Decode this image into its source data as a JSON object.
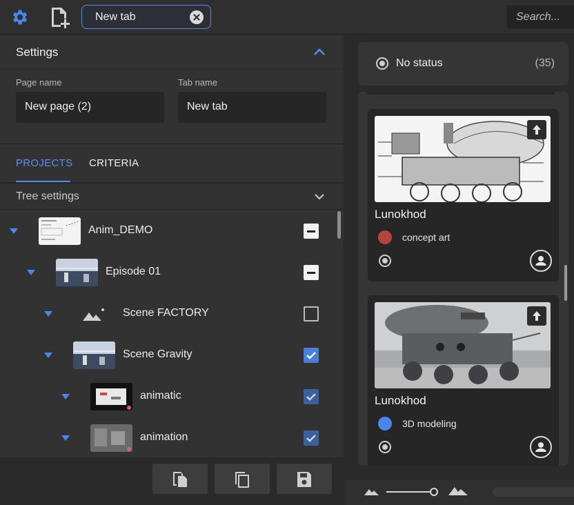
{
  "topbar": {
    "tab_name": "New tab",
    "search_placeholder": "Search..."
  },
  "settings": {
    "title": "Settings",
    "page_name_label": "Page name",
    "page_name_value": "New page (2)",
    "tab_name_label": "Tab name",
    "tab_name_value": "New tab"
  },
  "tabs": [
    {
      "label": "PROJECTS",
      "active": true
    },
    {
      "label": "CRITERIA",
      "active": false
    }
  ],
  "tree_settings_label": "Tree settings",
  "tree": [
    {
      "label": "Anim_DEMO",
      "depth": 0,
      "check": "indeterminate"
    },
    {
      "label": "Episode 01",
      "depth": 1,
      "check": "indeterminate"
    },
    {
      "label": "Scene FACTORY",
      "depth": 2,
      "check": "unchecked"
    },
    {
      "label": "Scene Gravity",
      "depth": 2,
      "check": "checked"
    },
    {
      "label": "animatic",
      "depth": 3,
      "check": "checked"
    },
    {
      "label": "animation",
      "depth": 3,
      "check": "checked"
    }
  ],
  "status": {
    "label": "No status",
    "count": "(35)"
  },
  "cards": [
    {
      "title": "Lunokhod",
      "tag": "concept art",
      "tag_color": "#b5443c"
    },
    {
      "title": "Lunokhod",
      "tag": "3D modeling",
      "tag_color": "#4a86ef"
    }
  ],
  "colors": {
    "accent": "#5b8df0",
    "checkbox": "#4a7fd9"
  }
}
